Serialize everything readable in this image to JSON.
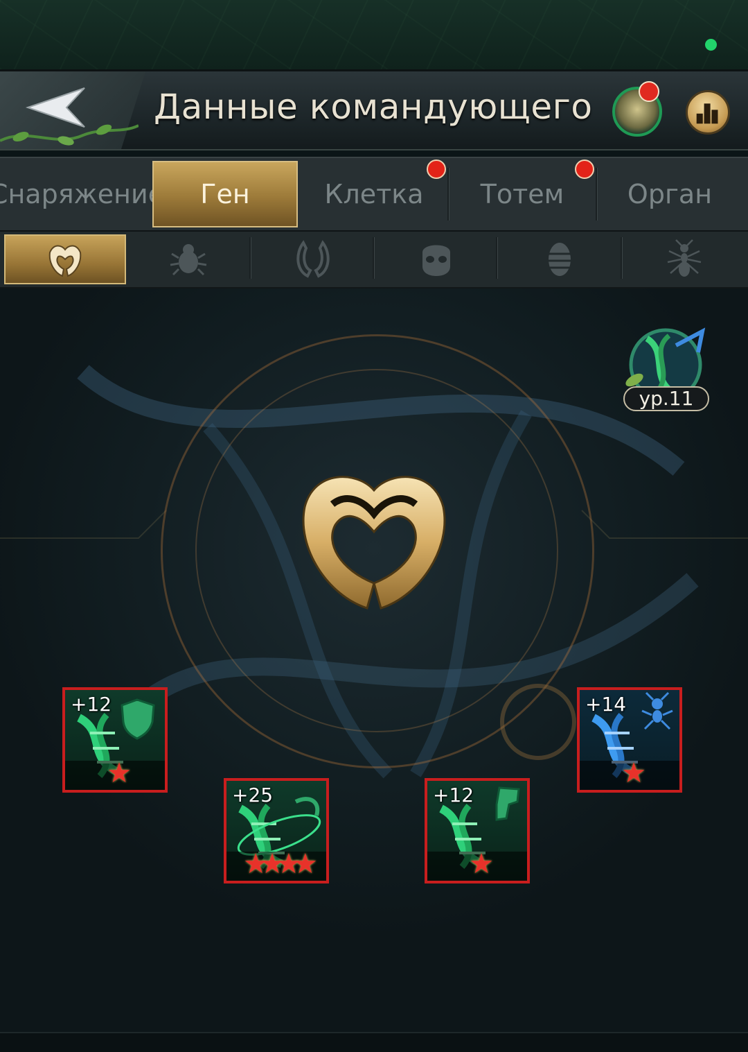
{
  "header": {
    "title": "Данные командующего"
  },
  "tabs": [
    {
      "label": "Снаряжение",
      "active": false,
      "badge": false
    },
    {
      "label": "Ген",
      "active": true,
      "badge": false
    },
    {
      "label": "Клетка",
      "active": false,
      "badge": true
    },
    {
      "label": "Тотем",
      "active": false,
      "badge": true
    },
    {
      "label": "Орган",
      "active": false,
      "badge": false
    }
  ],
  "subtabs": [
    {
      "icon": "horned-emblem-icon",
      "active": true
    },
    {
      "icon": "beetle-icon",
      "active": false
    },
    {
      "icon": "mandible-icon",
      "active": false
    },
    {
      "icon": "skull-icon",
      "active": false
    },
    {
      "icon": "larva-icon",
      "active": false
    },
    {
      "icon": "ant-icon",
      "active": false
    }
  ],
  "level": {
    "label": "ур.11"
  },
  "genes": [
    {
      "plus": "+12",
      "stars": "★",
      "star_count": 1,
      "color": "green",
      "icon": "shield-dna-icon"
    },
    {
      "plus": "+25",
      "stars": "★★★★",
      "star_count": 4,
      "color": "green",
      "icon": "orbit-dna-icon"
    },
    {
      "plus": "+12",
      "stars": "★",
      "star_count": 1,
      "color": "green",
      "icon": "boot-dna-icon"
    },
    {
      "plus": "+14",
      "stars": "★",
      "star_count": 1,
      "color": "blue",
      "icon": "ant-dna-icon"
    }
  ],
  "colors": {
    "gold": "#c9a65d",
    "badge_red": "#e32318",
    "status_green": "#22d46b",
    "gene_border": "#c81e1e"
  }
}
